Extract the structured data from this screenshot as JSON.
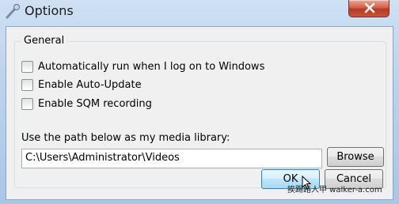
{
  "window": {
    "title": "Options",
    "icon": "wrench-icon",
    "close_icon": "close-icon"
  },
  "general": {
    "group_label": "General",
    "options": [
      {
        "label": "Automatically run when I log on to Windows",
        "checked": false
      },
      {
        "label": "Enable Auto-Update",
        "checked": false
      },
      {
        "label": "Enable SQM recording",
        "checked": false
      }
    ],
    "path_label": "Use the path below as my media library:",
    "path_value": "C:\\Users\\Administrator\\Videos",
    "browse_label": "Browse"
  },
  "footer": {
    "ok_label": "OK",
    "cancel_label": "Cancel"
  },
  "watermark": "挨踢路人甲 walker-a.com",
  "colors": {
    "accent": "#3c7fb1",
    "close": "#c7533a"
  }
}
